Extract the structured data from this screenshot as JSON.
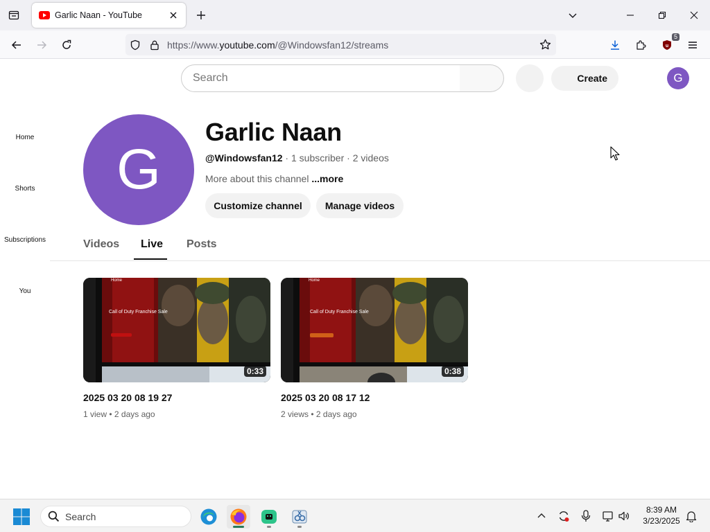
{
  "browser": {
    "tab": {
      "title": "Garlic Naan - YouTube"
    },
    "url": {
      "prefix": "https://www.",
      "host": "youtube.com",
      "path": "/@Windowsfan12/streams"
    },
    "extension_badge": "5"
  },
  "masthead": {
    "search_placeholder": "Search",
    "create_label": "Create",
    "account_initial": "G"
  },
  "guide": {
    "items": [
      {
        "label": "Home"
      },
      {
        "label": "Shorts"
      },
      {
        "label": "Subscriptions"
      },
      {
        "label": "You"
      }
    ]
  },
  "channel": {
    "avatar_initial": "G",
    "avatar_color": "#7e57c2",
    "name": "Garlic Naan",
    "handle": "@Windowsfan12",
    "subscribers": "1 subscriber",
    "video_count": "2 videos",
    "separator": " · ",
    "about": "More about this channel",
    "more": "...more",
    "customize_label": "Customize channel",
    "manage_label": "Manage videos"
  },
  "tabs": [
    {
      "label": "Videos",
      "active": false
    },
    {
      "label": "Live",
      "active": true
    },
    {
      "label": "Posts",
      "active": false
    }
  ],
  "videos": [
    {
      "title": "2025 03 20 08 19 27",
      "duration": "0:33",
      "views": "1 view",
      "age": "2 days ago",
      "thumb_text": "Call of Duty Franchise Sale",
      "thumb_header": "Home"
    },
    {
      "title": "2025 03 20 08 17 12",
      "duration": "0:38",
      "views": "2 views",
      "age": "2 days ago",
      "thumb_text": "Call of Duty Franchise Sale",
      "thumb_header": "Home"
    }
  ],
  "taskbar": {
    "search_label": "Search",
    "time": "8:39 AM",
    "date": "3/23/2025"
  },
  "colors": {
    "accent_red": "#ff0000",
    "text_primary": "#0f0f0f",
    "text_secondary": "#606060"
  }
}
